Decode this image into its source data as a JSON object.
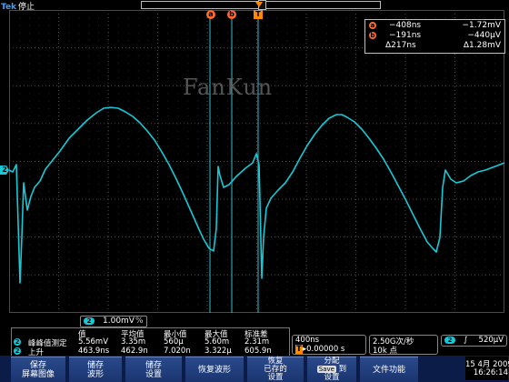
{
  "header": {
    "brand": "Tek",
    "status": "停止"
  },
  "watermark": "FanKun",
  "markers": {
    "cursor_a": "a",
    "cursor_b": "b",
    "trigger": "T",
    "channel": "2"
  },
  "cursor_readout": {
    "a_time": "−408ns",
    "a_volt": "−1.72mV",
    "b_time": "−191ns",
    "b_volt": "−440µV",
    "delta_time": "Δ217ns",
    "delta_volt": "Δ1.28mV"
  },
  "channel_scale": "1.00mV",
  "channel_bw": "%",
  "measurements": {
    "headers": [
      "值",
      "平均值",
      "最小值",
      "最大值",
      "标准差"
    ],
    "rows": [
      {
        "ch": "2",
        "name": "峰峰值测定",
        "values": [
          "5.56mV",
          "3.35m",
          "560µ",
          "5.60m",
          "2.31m"
        ]
      },
      {
        "ch": "2",
        "name": "上升",
        "values": [
          "463.9ns",
          "462.9n",
          "7.020n",
          "3.322µ",
          "605.9n"
        ]
      }
    ]
  },
  "timebase": {
    "scale": "400ns",
    "position_label": "T",
    "position_value": "▸0.00000 s"
  },
  "acquisition": {
    "rate": "2.50G次/秒",
    "points": "10k 点"
  },
  "trigger_info": {
    "channel": "2",
    "slope": "∫",
    "level": "520µV"
  },
  "datetime": {
    "date": "15 4月 2009",
    "time": "16:26:14"
  },
  "buttons": [
    {
      "label": "保存\n屏幕图像"
    },
    {
      "label": "储存\n波形"
    },
    {
      "label": "储存\n设置"
    },
    {
      "label": "恢复波形"
    },
    {
      "label": "恢复\n已存的\n设置"
    },
    {
      "label": "分配\nSave 到\n设置"
    },
    {
      "label": "文件功能"
    }
  ],
  "save_key": "Save",
  "colors": {
    "trace": "#16c9d8",
    "cursor": "#33bfd0",
    "marker_orange": "#ff6a2a",
    "button_blue": "#23427f"
  }
}
